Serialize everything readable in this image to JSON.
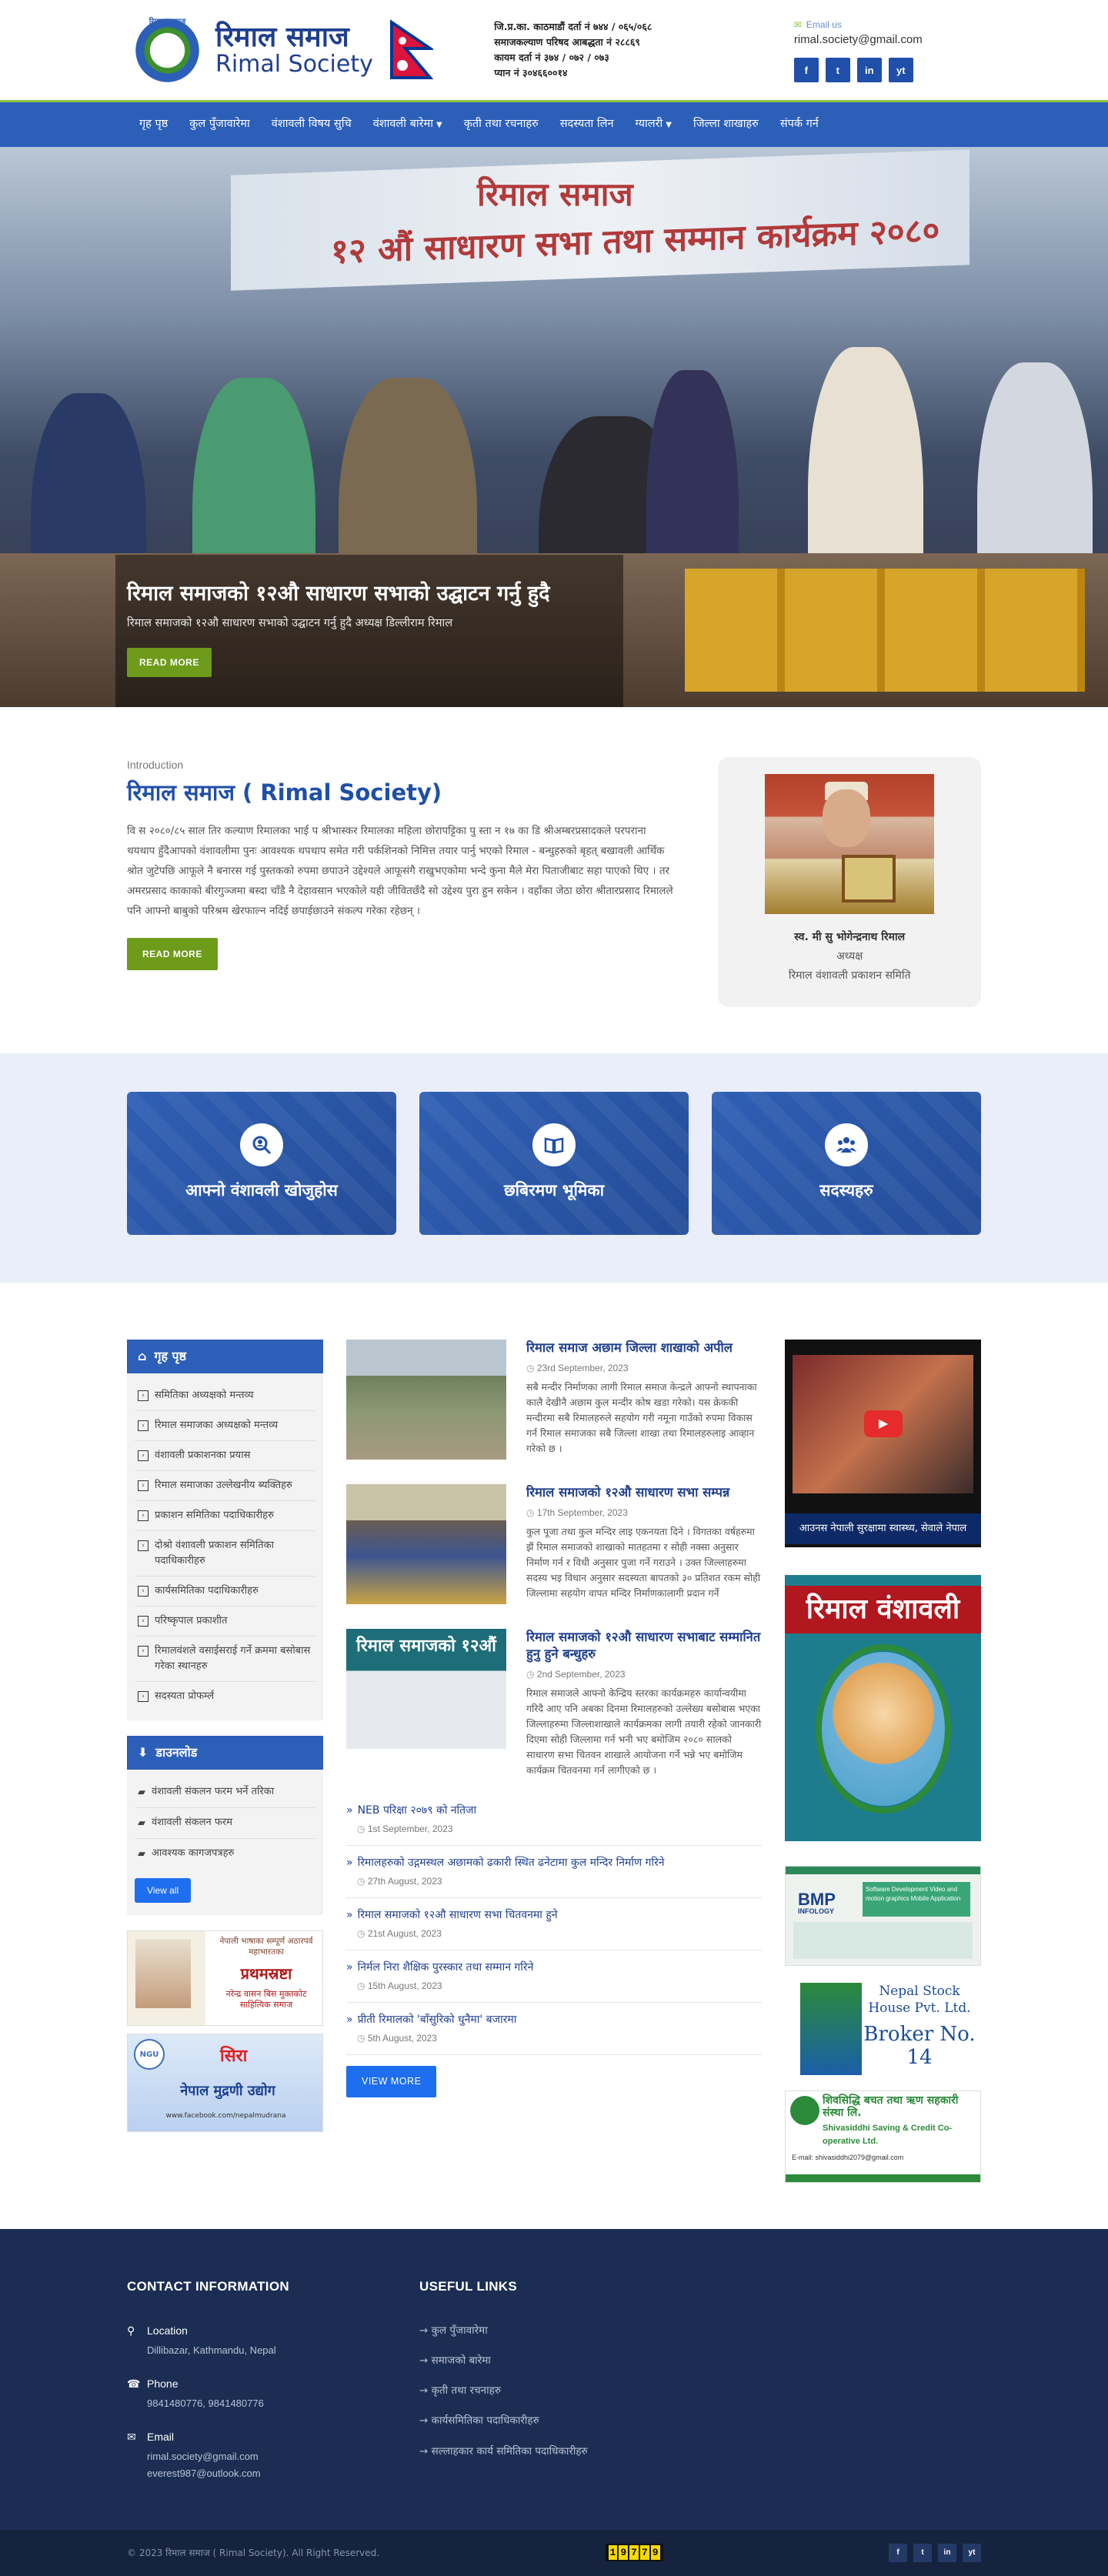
{
  "header": {
    "logo_np": "रिमाल समाज",
    "logo_en": "Rimal Society",
    "logo_ring": "रिमाल समाज",
    "reg_lines": [
      "जि.प्र.का. काठमाडौं दर्ता नं ७४४ / ०६५/०६८",
      "समाजकल्याण परिषद आबद्धता नं २८८६९",
      "कायम दर्ता नं ३७४ / ०७२ / ०७३",
      "प्यान नं ३०४६६००१४"
    ],
    "email_label": "Email us",
    "email": "rimal.society@gmail.com",
    "socials": [
      "f",
      "t",
      "in",
      "yt"
    ]
  },
  "nav": {
    "items": [
      {
        "label": "गृह पृष्ठ",
        "caret": false
      },
      {
        "label": "कुल पुँजावारेमा",
        "caret": false
      },
      {
        "label": "वंशावली विषय सुचि",
        "caret": false
      },
      {
        "label": "वंशावली बारेमा",
        "caret": true
      },
      {
        "label": "कृती तथा रचनाहरु",
        "caret": false
      },
      {
        "label": "सदस्यता लिन",
        "caret": false
      },
      {
        "label": "ग्यालरी",
        "caret": true
      },
      {
        "label": "जिल्ला शाखाहरु",
        "caret": false
      },
      {
        "label": "संपर्क गर्न",
        "caret": false
      }
    ]
  },
  "hero": {
    "banner_line1": "रिमाल समाज",
    "banner_line2": "१२ औं साधारण सभा तथा सम्मान कार्यक्रम २०८०",
    "title": "रिमाल समाजको १२औ साधारण सभाको उद्घाटन गर्नु हुदै",
    "subtitle": "रिमाल समाजको १२औ साधारण सभाको उद्घाटन गर्नु हुदै अध्यक्ष डिल्लीराम रिमाल",
    "button": "READ MORE"
  },
  "intro": {
    "eyebrow": "Introduction",
    "title": "रिमाल समाज ( Rimal Society)",
    "body": "वि स २०८०/८५ साल तिर कल्याण रिमालका भाई प श्रीभास्कर रिमालका महिला छोरापट्टिका पु स्ता न १७ का डि श्रीअम्बरप्रसादकले परपराना थयथाप हुँदैआपको वंशावलीमा पुनः आवश्यक थपथाप समेत गरी पर्कशिनको निमित्त तयार पार्नु भएको रिमाल - बन्धुहरुको बृहत् बखावली आर्थिक श्रोत जुटेपछि आफूले नै बनारस गई पुस्तकको रुपमा छपाउने उद्देश्यले आफूसंगै राखुभएकोमा भन्दे कुना मैले मेरा पिताजीबाट सहा पाएको थिए । तर अमरप्रसाद काकाको बीरगुञ्जमा बस्दा चाँडै नै देहावसान भएकोले यही जीवितछँदै सो उद्देश्य पुरा हुन सकेन । वहाँका जेठा छोरा श्रीतारप्रसाद रिमालले पनि आफ्नो बाबुको परिश्रम खेरफाल्न नदिई छपाईछाउने संकल्प गरेका रहेछन् ।",
    "button": "READ MORE",
    "chair_name": "स्व. मी सु भोगेन्द्रनाथ रिमाल",
    "chair_role": "अध्यक्ष",
    "chair_org": "रिमाल वंशावली प्रकाशन समिति"
  },
  "features": [
    {
      "label": "आफ्नो वंशावली खोजुहोस",
      "icon": "search-user-icon"
    },
    {
      "label": "छबिरमण भूमिका",
      "icon": "book-icon"
    },
    {
      "label": "सदस्यहरु",
      "icon": "users-icon"
    }
  ],
  "sidebar": {
    "home_title": "गृह पृष्ठ",
    "home_items": [
      "समितिका अध्यक्षको मन्तव्य",
      "रिमाल समाजका अध्यक्षको मन्तव्य",
      "वंशावली प्रकाशनका प्रयास",
      "रिमाल समाजका उल्लेखनीय ब्यक्तिहरु",
      "प्रकाशन समितिका पदाधिकारीहरु",
      "दोश्रो वंशावली प्रकाशन समितिका पदाधिकारीहरु",
      "कार्यसमितिका पदाधिकारीहरु",
      "परिष्कृपाल प्रकाशीत",
      "रिमालवंशले वसाईसराई गर्ने क्रममा बसोबास गरेका स्थानहरु",
      "सदस्यता प्रोफर्म्ल"
    ],
    "download_title": "डाउनलोड",
    "download_items": [
      "वंशावली संकलन फरम भर्ने तरिका",
      "वंशावली संकलन फरम",
      "आवश्यक कागजपत्रहरु"
    ],
    "view_all": "View all",
    "ad1": {
      "top": "नेपाली भाषाका सम्पूर्ण अठारपर्व महाभारतका",
      "big": "प्रथमस्रष्टा",
      "bottom": "नरेन्द्र वासन बिस मुक्तकोट साहित्यिक समाज"
    },
    "ad2": {
      "logo": "NGU",
      "brand": "सिरा",
      "title": "नेपाल मुद्रणी उद्योग",
      "contact": "www.facebook.com/nepalmudrana"
    }
  },
  "news": {
    "posts": [
      {
        "title": "रिमाल समाज अछाम जिल्ला शाखाको अपील",
        "date": "23rd September, 2023",
        "excerpt": "सबै मन्दीर निर्माणका लागी रिमाल समाज केन्द्रले आफ्नो स्थापनाका कालै देखीनै अछाम कुल मन्दीर कोष खडा गरेको। यस क्रेककी मन्दीरमा सबै रिमालहरुले सहयोग गरी नमूना गाउँको रुपमा विकास गर्न रिमाल समाजका सबै जिल्ला शाखा तथा रिमालहरुलाइ आव्हान गरेको छ ।"
      },
      {
        "title": "रिमाल समाजको १२औ साधारण सभा सम्पन्न",
        "date": "17th September, 2023",
        "excerpt": "कुल पूजा तथा कुल मन्दिर लाइ एकनयता दिने । विगतका वर्षहरुमा झैं रिमाल समाजको शाखाको मातहतमा र सोही नक्सा अनुसार निर्माण गर्न र विधी अनुसार पुजा गर्ने गराउने । उक्त जिल्लाहरुमा सदस्य भइ विधान अनुसार सदस्यता बापतको ३० प्रतिशत रकम सोही जिल्लामा सहयोग वापत मन्दिर निर्माणकालागी प्रदान गर्ने"
      },
      {
        "title": "रिमाल समाजको १२औ साधारण सभाबाट सम्मानित हुनु हुने बन्धुहरु",
        "date": "2nd September, 2023",
        "excerpt": "रिमाल समाजले आफ्नो केन्द्रिय स्तरका कार्यक्रमहरु कार्यान्वयीमा गरिदै आए पनि अबका दिनमा रिमालहरुको उल्लेख्य बसोबास भएका जिल्लाहरुमा जिल्लाशाखाले कार्यक्रमका लागी तयारी रहेको जानकारी दिएमा सोही जिल्लामा गर्न भनी भए बमोजिम २०८० सालको साधारण सभा चितवन शाखाले आयोजना गर्ने भन्ने भए बमोजिम कार्यक्रम चितवनमा गर्न लागीएको छ ।",
        "thumb_label": "रिमाल समाजको १२औं"
      }
    ],
    "more": [
      {
        "title": "NEB परिक्षा २०७९ को नतिजा",
        "date": "1st September, 2023"
      },
      {
        "title": "रिमालहरुको उद्गमस्थल अछामको ढकारी स्थित ढनेटामा कुल मन्दिर निर्माण गरिने",
        "date": "27th August, 2023"
      },
      {
        "title": "रिमाल समाजको १२औ साधारण सभा चितवनमा हुने",
        "date": "21st August, 2023"
      },
      {
        "title": "निर्मल निरा शैक्षिक पुरस्कार तथा सम्मान गरिने",
        "date": "15th August, 2023"
      },
      {
        "title": "प्रीती रिमालको 'बाँसुरिको धुनैमा' बजारमा",
        "date": "5th August, 2023"
      }
    ],
    "view_more": "VIEW MORE"
  },
  "rside": {
    "video_caption": "आउनस नेपाली सुरक्षामा स्वास्थ्य, सेवाले नेपाल",
    "book_title": "रिमाल वंशावली",
    "bmp_brand": "BMP",
    "bmp_tag": "INFOLOGY",
    "bmp_service": "Software Development Video and motion graphics Mobile Application",
    "nsh_title": "Nepal Stock House Pvt. Ltd.",
    "nsh_broker": "Broker No. 14",
    "shiva_np": "शिवसिद्धि बचत तथा ऋण सहकारी संस्था लि.",
    "shiva_en": "Shivasiddhi Saving & Credit Co-operative Ltd.",
    "shiva_addr": "E-mail: shivasiddhi2079@gmail.com"
  },
  "footer": {
    "contact_title": "CONTACT INFORMATION",
    "location_label": "Location",
    "location": "Dillibazar, Kathmandu, Nepal",
    "phone_label": "Phone",
    "phone": "9841480776, 9841480776",
    "email_label": "Email",
    "email1": "rimal.society@gmail.com",
    "email2": "everest987@outlook.com",
    "links_title": "USEFUL LINKS",
    "links": [
      "कुल पुँजावारेमा",
      "समाजको बारेमा",
      "कृती तथा रचनाहरु",
      "कार्यसमितिका पदाधिकारीहरु",
      "सल्लाहकार कार्य समितिका पदाधिकारीहरु"
    ],
    "copyright": "© 2023 रिमाल समाज ( Rimal Society). All Right Reserved.",
    "counter": "19779"
  },
  "colors": {
    "primary": "#2c5fb8",
    "accent_green": "#6e9b1a",
    "footer_bg": "#1b2d52"
  }
}
